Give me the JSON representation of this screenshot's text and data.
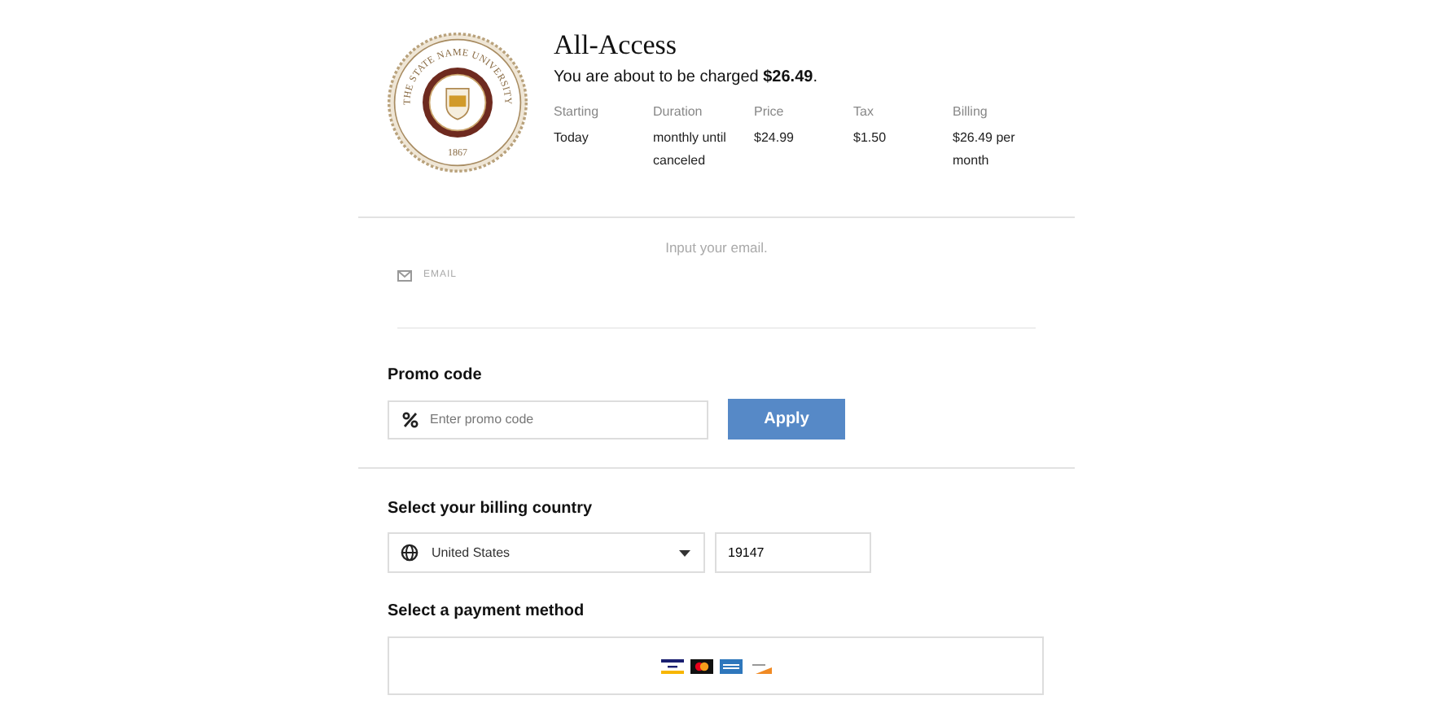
{
  "seal": {
    "ring_text": "THE STATE NAME UNIVERSITY",
    "year": "1867"
  },
  "plan": {
    "title": "All-Access",
    "charge": "You are about to be charged **$26.49**."
  },
  "details": [
    {
      "label": "Starting",
      "value": "Today"
    },
    {
      "label": "Duration",
      "value": "monthly until canceled"
    },
    {
      "label": "Price",
      "value": "$24.99"
    },
    {
      "label": "Tax",
      "value": "$1.50"
    },
    {
      "label": "Billing",
      "value": "$26.49 per month"
    }
  ],
  "email": {
    "prompt": "Input your email.",
    "label": "EMAIL"
  },
  "promo": {
    "heading": "Promo code",
    "placeholder": "Enter promo code",
    "button": "Apply"
  },
  "billing": {
    "heading": "Select your billing country",
    "country": "United States",
    "postal_code": "19147"
  },
  "payment": {
    "heading": "Select a payment method"
  }
}
